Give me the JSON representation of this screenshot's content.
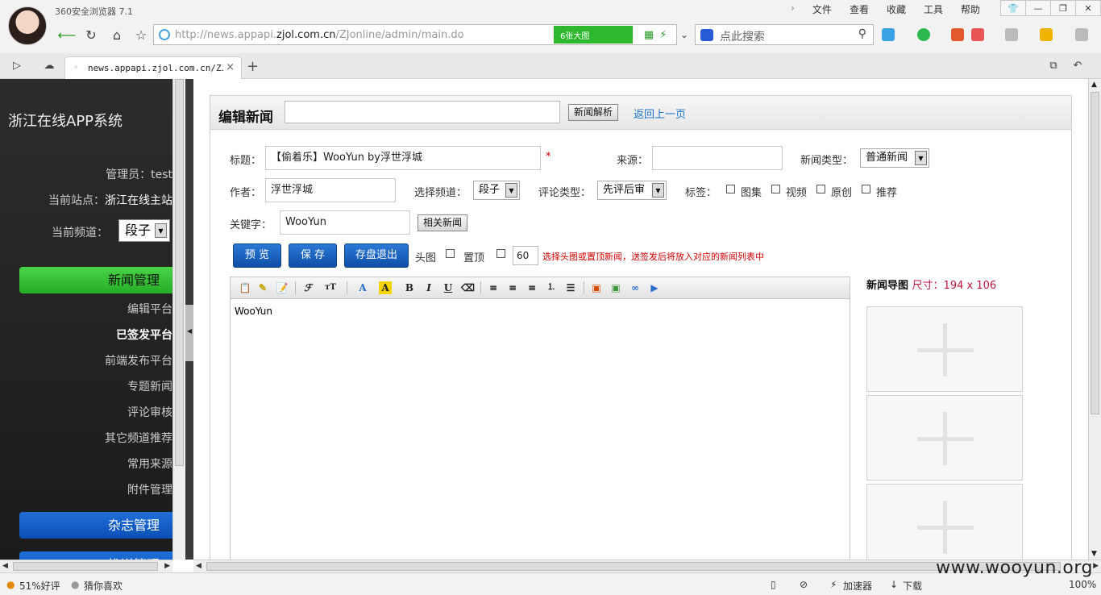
{
  "browser": {
    "title": "360安全浏览器 7.1",
    "menu": [
      "文件",
      "查看",
      "收藏",
      "工具",
      "帮助"
    ],
    "url_prefix": "http://news.appapi.",
    "url_domain": "zjol.com.cn",
    "url_suffix": "/ZJonline/admin/main.do",
    "bigpic_label": "6张大图",
    "search_placeholder": "点此搜索",
    "tab_title": "news.appapi.zjol.com.cn/ZJonl",
    "tab_close": "×",
    "new_tab": "+"
  },
  "sidebar": {
    "system_title": "浙江在线APP系统",
    "admin_label": "管理员：",
    "admin_value": "test",
    "site_label": "当前站点：",
    "site_value": "浙江在线主站",
    "channel_label": "当前频道：",
    "channel_value": "段子",
    "group_news": "新闻管理",
    "items": [
      "编辑平台",
      "已签发平台",
      "前端发布平台",
      "专题新闻",
      "评论审核",
      "其它频道推荐",
      "常用来源",
      "附件管理"
    ],
    "group_magazine": "杂志管理",
    "group_push": "推送管理"
  },
  "page": {
    "title": "编辑新闻",
    "parse_button": "新闻解析",
    "back_link": "返回上一页",
    "title_label": "标题：",
    "title_value": "【偷着乐】WooYun by浮世浮城",
    "required_mark": "*",
    "source_label": "来源：",
    "source_value": "",
    "news_type_label": "新闻类型：",
    "news_type_value": "普通新闻",
    "author_label": "作者：",
    "author_value": "浮世浮城",
    "channel_label": "选择频道：",
    "channel_value": "段子",
    "comment_type_label": "评论类型：",
    "comment_type_value": "先评后审",
    "tags_label": "标签：",
    "tags": [
      "图集",
      "视频",
      "原创",
      "推荐"
    ],
    "keyword_label": "关键字：",
    "keyword_value": "WooYun",
    "related_button": "相关新闻",
    "preview_button": "预 览",
    "save_button": "保 存",
    "save_exit_button": "存盘退出",
    "headline_label": "头图",
    "top_label": "置顶",
    "top_value": "60",
    "hint": "选择头图或置顶新闻，送签发后将放入对应的新闻列表中",
    "editor_content": "WooYun",
    "thumb_title": "新闻导图",
    "thumb_size": "尺寸：194 x 106"
  },
  "statusbar": {
    "rating": "51%好评",
    "guess": "猜你喜欢",
    "accelerator": "加速器",
    "download": "下载",
    "zoom": "100%"
  },
  "watermark": "www.wooyun.org"
}
